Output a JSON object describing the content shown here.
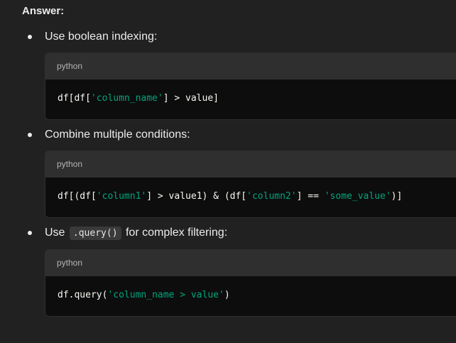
{
  "answer": {
    "heading": "Answer:"
  },
  "items": [
    {
      "text": "Use boolean indexing:",
      "code": {
        "lang": "python",
        "tokens": [
          {
            "t": "df[df[",
            "s": false
          },
          {
            "t": "'column_name'",
            "s": true
          },
          {
            "t": "] > value]",
            "s": false
          }
        ]
      }
    },
    {
      "text": "Combine multiple conditions:",
      "code": {
        "lang": "python",
        "tokens": [
          {
            "t": "df[(df[",
            "s": false
          },
          {
            "t": "'column1'",
            "s": true
          },
          {
            "t": "] > value1) & (df[",
            "s": false
          },
          {
            "t": "'column2'",
            "s": true
          },
          {
            "t": "] == ",
            "s": false
          },
          {
            "t": "'some_value'",
            "s": true
          },
          {
            "t": ")]",
            "s": false
          }
        ]
      }
    },
    {
      "text_before": "Use",
      "inline_code": ".query()",
      "text_after": "for complex filtering:",
      "code": {
        "lang": "python",
        "tokens": [
          {
            "t": "df.query(",
            "s": false
          },
          {
            "t": "'column_name > value'",
            "s": true
          },
          {
            "t": ")",
            "s": false
          }
        ]
      }
    }
  ],
  "colors": {
    "background": "#212121",
    "code_header": "#2f2f2f",
    "code_body": "#0d0d0d",
    "string": "#00a67d",
    "text": "#ececec"
  }
}
